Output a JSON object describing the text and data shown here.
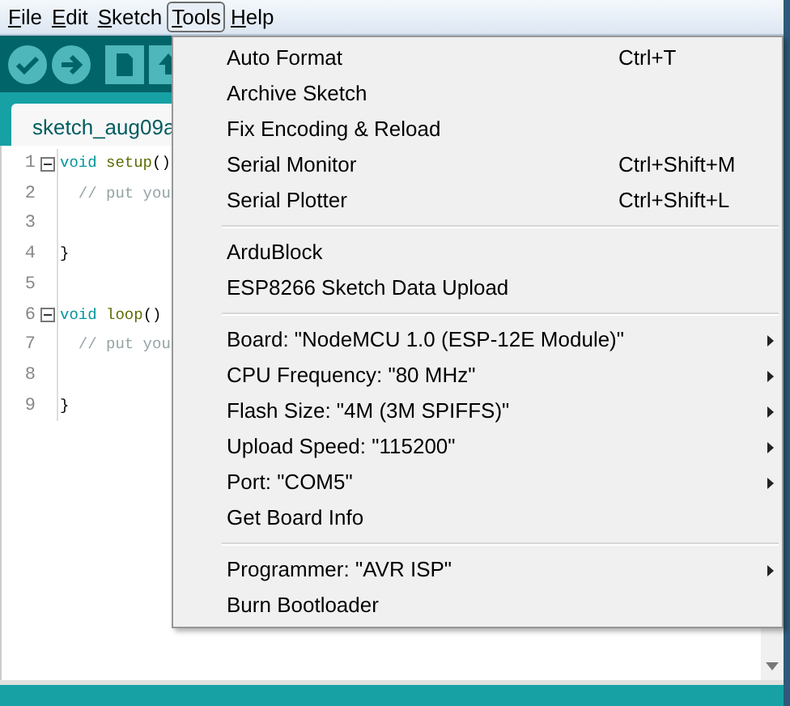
{
  "menu_bar": [
    {
      "label": "File",
      "selected": false
    },
    {
      "label": "Edit",
      "selected": false
    },
    {
      "label": "Sketch",
      "selected": false
    },
    {
      "label": "Tools",
      "selected": true
    },
    {
      "label": "Help",
      "selected": false
    }
  ],
  "tabs": [
    {
      "label": "sketch_aug09a",
      "selected": true
    }
  ],
  "editor": {
    "lines": [
      {
        "number": "1",
        "fold": true,
        "code": [
          {
            "kind": "keyword",
            "text": "void"
          },
          {
            "kind": "function",
            "text": "setup"
          },
          {
            "kind": "plain",
            "text": "()"
          }
        ]
      },
      {
        "number": "2",
        "fold": false,
        "code": [
          {
            "kind": "comment",
            "text": "  // put you"
          }
        ]
      },
      {
        "number": "3",
        "fold": false
      },
      {
        "number": "4",
        "fold": false,
        "code": [
          {
            "kind": "plain",
            "text": "}"
          }
        ]
      },
      {
        "number": "5",
        "fold": false
      },
      {
        "number": "6",
        "fold": true,
        "code": [
          {
            "kind": "keyword",
            "text": "void"
          },
          {
            "kind": "function",
            "text": "loop"
          },
          {
            "kind": "plain",
            "text": "()"
          }
        ]
      },
      {
        "number": "7",
        "fold": false,
        "code": [
          {
            "kind": "comment",
            "text": "  // put you"
          }
        ]
      },
      {
        "number": "8",
        "fold": false
      },
      {
        "number": "9",
        "fold": false,
        "code": [
          {
            "kind": "plain",
            "text": "}"
          }
        ]
      }
    ]
  },
  "tools_menu": {
    "sections": [
      [
        {
          "label": "Auto Format",
          "shortcut": "Ctrl+T",
          "submenu": false
        },
        {
          "label": "Archive Sketch",
          "submenu": false
        },
        {
          "label": "Fix Encoding & Reload",
          "submenu": false
        },
        {
          "label": "Serial Monitor",
          "shortcut": "Ctrl+Shift+M",
          "submenu": false
        },
        {
          "label": "Serial Plotter",
          "shortcut": "Ctrl+Shift+L",
          "submenu": false
        }
      ],
      [
        {
          "label": "ArduBlock",
          "submenu": false
        },
        {
          "label": "ESP8266 Sketch Data Upload",
          "submenu": false
        }
      ],
      [
        {
          "label": "Board: \"NodeMCU 1.0 (ESP-12E Module)\"",
          "submenu": true
        },
        {
          "label": "CPU Frequency: \"80 MHz\"",
          "submenu": true
        },
        {
          "label": "Flash Size: \"4M (3M SPIFFS)\"",
          "submenu": true
        },
        {
          "label": "Upload Speed: \"115200\"",
          "submenu": true
        },
        {
          "label": "Port: \"COM5\"",
          "submenu": true
        },
        {
          "label": "Get Board Info",
          "submenu": false
        }
      ],
      [
        {
          "label": "Programmer: \"AVR ISP\"",
          "submenu": true
        },
        {
          "label": "Burn Bootloader",
          "submenu": false
        }
      ]
    ]
  }
}
